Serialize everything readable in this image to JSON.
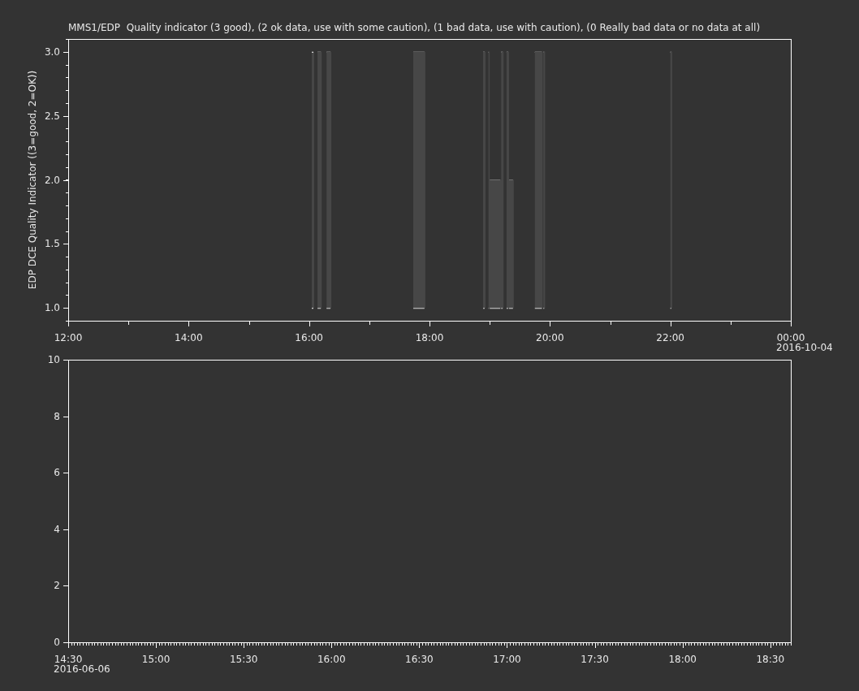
{
  "panels": [
    {
      "title": "MMS1/EDP  Quality indicator (3 good), (2 ok data, use with some caution), (1 bad data, use with caution), (0 Really bad data or no data at all)",
      "date_label": "2016-10-04",
      "chart_data": {
        "type": "area",
        "ylabel": "EDP DCE Quality Indicator ((3=good, 2=OK))",
        "x": [
          16.045,
          16.085,
          null,
          16.14,
          16.21,
          null,
          16.29,
          16.37,
          null,
          17.73,
          17.93,
          null,
          18.89,
          18.93,
          null,
          18.98,
          19.0,
          19.0,
          19.19,
          19.19,
          19.23,
          null,
          19.28,
          19.32,
          19.32,
          19.4,
          null,
          19.75,
          19.88,
          null,
          19.89,
          19.92,
          null,
          22.0,
          22.03
        ],
        "series": [
          {
            "color": "#474747",
            "values": [
              3,
              3,
              null,
              3,
              3,
              null,
              3,
              3,
              null,
              3,
              3,
              null,
              3,
              3,
              null,
              3,
              3,
              2,
              2,
              3,
              3,
              null,
              3,
              3,
              2,
              2,
              null,
              3,
              3,
              null,
              3,
              3,
              null,
              3,
              3
            ]
          }
        ],
        "xlim": [
          12,
          24
        ],
        "ylim": [
          0.9,
          3.1
        ],
        "xticks": [
          {
            "value": 12,
            "label": "12:00"
          },
          {
            "value": 14,
            "label": "14:00"
          },
          {
            "value": 16,
            "label": "16:00"
          },
          {
            "value": 18,
            "label": "18:00"
          },
          {
            "value": 20,
            "label": "20:00"
          },
          {
            "value": 22,
            "label": "22:00"
          },
          {
            "value": 24,
            "label": "00:00"
          }
        ],
        "yticks": [
          {
            "value": 1,
            "label": "1.0"
          },
          {
            "value": 1.5,
            "label": "1.5"
          },
          {
            "value": 2,
            "label": "2.0"
          },
          {
            "value": 2.5,
            "label": "2.5"
          },
          {
            "value": 3,
            "label": "3.0"
          }
        ]
      }
    },
    {
      "date_label": "2016-06-06",
      "chart_data": {
        "type": "line",
        "xlim": [
          14.5,
          18.6167
        ],
        "ylim": [
          0,
          10
        ],
        "xticks": [
          {
            "value": 14.5,
            "label": "14:30"
          },
          {
            "value": 15,
            "label": "15:00"
          },
          {
            "value": 15.5,
            "label": "15:30"
          },
          {
            "value": 16,
            "label": "16:00"
          },
          {
            "value": 16.5,
            "label": "16:30"
          },
          {
            "value": 17,
            "label": "17:00"
          },
          {
            "value": 17.5,
            "label": "17:30"
          },
          {
            "value": 18,
            "label": "18:00"
          },
          {
            "value": 18.5,
            "label": "18:30"
          }
        ],
        "yticks": [
          {
            "value": 0,
            "label": "0"
          },
          {
            "value": 2,
            "label": "2"
          },
          {
            "value": 4,
            "label": "4"
          },
          {
            "value": 6,
            "label": "6"
          },
          {
            "value": 8,
            "label": "8"
          },
          {
            "value": 10,
            "label": "10"
          }
        ]
      }
    }
  ]
}
